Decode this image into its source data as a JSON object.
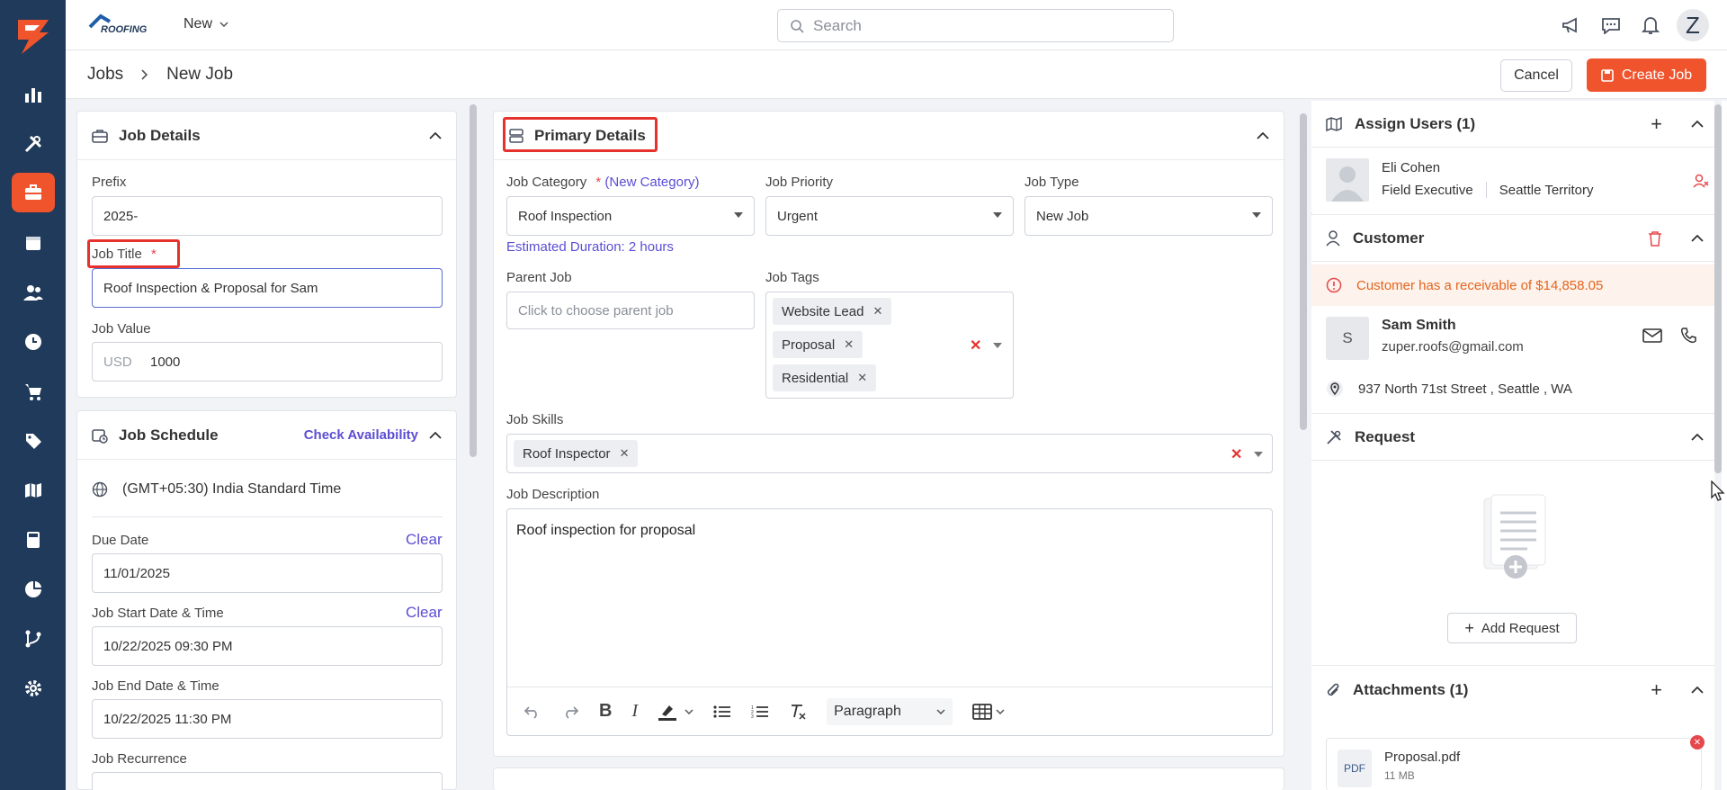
{
  "brand": {
    "logo_text": "ROOFING",
    "new_menu": "New"
  },
  "search": {
    "placeholder": "Search"
  },
  "user": {
    "avatar_initial": "Z"
  },
  "breadcrumb": {
    "parent": "Jobs",
    "current": "New Job"
  },
  "actions": {
    "cancel": "Cancel",
    "create": "Create Job"
  },
  "job_details": {
    "title": "Job Details",
    "prefix_label": "Prefix",
    "prefix_value": "2025-",
    "job_title_label": "Job Title",
    "required_mark": "*",
    "job_title_value": "Roof Inspection & Proposal for Sam",
    "job_value_label": "Job Value",
    "currency": "USD",
    "job_value": "1000"
  },
  "job_schedule": {
    "title": "Job Schedule",
    "check_availability": "Check Availability",
    "timezone": "(GMT+05:30) India Standard Time",
    "due_date_label": "Due Date",
    "clear": "Clear",
    "due_date": "11/01/2025",
    "start_label": "Job Start Date & Time",
    "start_value": "10/22/2025 09:30 PM",
    "end_label": "Job End Date & Time",
    "end_value": "10/22/2025 11:30 PM",
    "recurrence_label": "Job Recurrence"
  },
  "primary": {
    "title": "Primary Details",
    "category_label": "Job Category",
    "new_category": "(New Category)",
    "category_value": "Roof Inspection",
    "estimated_duration": "Estimated Duration: 2 hours",
    "priority_label": "Job Priority",
    "priority_value": "Urgent",
    "type_label": "Job Type",
    "type_value": "New Job",
    "parent_label": "Parent Job",
    "parent_placeholder": "Click to choose parent job",
    "tags_label": "Job Tags",
    "tags": [
      "Website Lead",
      "Proposal",
      "Residential"
    ],
    "skills_label": "Job Skills",
    "skills": [
      "Roof Inspector"
    ],
    "description_label": "Job Description",
    "description": "Roof inspection for proposal",
    "paragraph_select": "Paragraph"
  },
  "assign_users": {
    "title": "Assign Users (1)",
    "name": "Eli Cohen",
    "role": "Field Executive",
    "territory": "Seattle Territory"
  },
  "customer": {
    "title": "Customer",
    "receivable_notice": "Customer has a receivable of $14,858.05",
    "initial": "S",
    "name": "Sam Smith",
    "email": "zuper.roofs@gmail.com",
    "address": "937 North 71st Street , Seattle , WA"
  },
  "request": {
    "title": "Request",
    "add_button": "Add Request"
  },
  "attachments": {
    "title": "Attachments (1)",
    "file_type": "PDF",
    "file_name": "Proposal.pdf",
    "file_size": "11 MB"
  },
  "colors": {
    "accent": "#f0542d",
    "nav": "#1f3a5a",
    "link": "#5b4ed3",
    "highlight": "#e5322d"
  }
}
